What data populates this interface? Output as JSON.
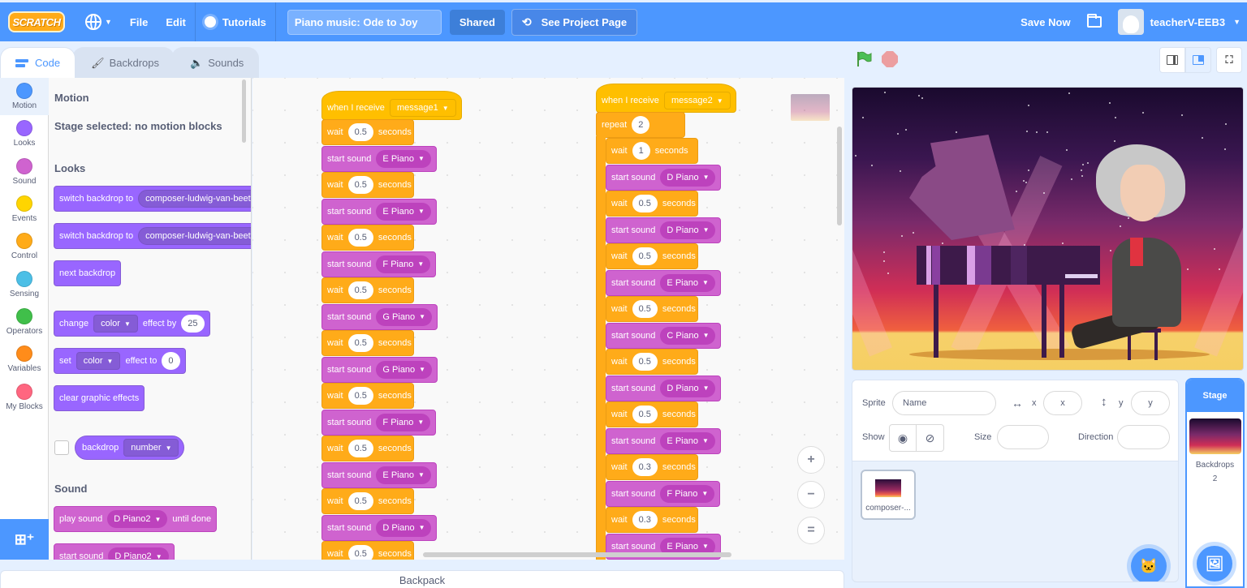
{
  "menubar": {
    "logo": "SCRATCH",
    "file": "File",
    "edit": "Edit",
    "tutorials": "Tutorials",
    "project_title": "Piano music: Ode to Joy",
    "shared": "Shared",
    "see_project_page": "See Project Page",
    "save_now": "Save Now",
    "username": "teacherV-EEB3"
  },
  "tabs": [
    {
      "label": "Code",
      "active": true
    },
    {
      "label": "Backdrops",
      "active": false
    },
    {
      "label": "Sounds",
      "active": false
    }
  ],
  "categories": [
    {
      "label": "Motion",
      "color": "#4c97ff"
    },
    {
      "label": "Looks",
      "color": "#9966ff"
    },
    {
      "label": "Sound",
      "color": "#cf63cf"
    },
    {
      "label": "Events",
      "color": "#ffd500"
    },
    {
      "label": "Control",
      "color": "#ffab19"
    },
    {
      "label": "Sensing",
      "color": "#4cbfe6"
    },
    {
      "label": "Operators",
      "color": "#40bf4a"
    },
    {
      "label": "Variables",
      "color": "#ff8c1a"
    },
    {
      "label": "My Blocks",
      "color": "#ff6680"
    }
  ],
  "palette": {
    "motion_heading": "Motion",
    "motion_note": "Stage selected: no motion blocks",
    "looks_heading": "Looks",
    "sound_heading": "Sound",
    "switch_backdrop_1": {
      "label": "switch backdrop to",
      "value": "composer-ludwig-van-beeth"
    },
    "switch_backdrop_2": {
      "label": "switch backdrop to",
      "value": "composer-ludwig-van-beeth"
    },
    "next_backdrop": "next backdrop",
    "change_effect": {
      "label1": "change",
      "dropdown": "color",
      "label2": "effect by",
      "value": "25"
    },
    "set_effect": {
      "label1": "set",
      "dropdown": "color",
      "label2": "effect to",
      "value": "0"
    },
    "clear_effects": "clear graphic effects",
    "backdrop_reporter": {
      "label": "backdrop",
      "dropdown": "number"
    },
    "play_sound": {
      "label1": "play sound",
      "dropdown": "D Piano2",
      "label2": "until done"
    },
    "start_sound": {
      "label": "start sound",
      "dropdown": "D Piano2"
    }
  },
  "scripts": {
    "script1": {
      "hat": {
        "label": "when I receive",
        "message": "message1"
      },
      "blocks": [
        {
          "type": "wait",
          "value": "0.5"
        },
        {
          "type": "sound",
          "note": "E Piano"
        },
        {
          "type": "wait",
          "value": "0.5"
        },
        {
          "type": "sound",
          "note": "E Piano"
        },
        {
          "type": "wait",
          "value": "0.5"
        },
        {
          "type": "sound",
          "note": "F Piano"
        },
        {
          "type": "wait",
          "value": "0.5"
        },
        {
          "type": "sound",
          "note": "G Piano"
        },
        {
          "type": "wait",
          "value": "0.5"
        },
        {
          "type": "sound",
          "note": "G Piano"
        },
        {
          "type": "wait",
          "value": "0.5"
        },
        {
          "type": "sound",
          "note": "F Piano"
        },
        {
          "type": "wait",
          "value": "0.5"
        },
        {
          "type": "sound",
          "note": "E Piano"
        },
        {
          "type": "wait",
          "value": "0.5"
        },
        {
          "type": "sound",
          "note": "D Piano"
        },
        {
          "type": "wait",
          "value": "0.5"
        }
      ]
    },
    "script2": {
      "hat": {
        "label": "when I receive",
        "message": "message2"
      },
      "repeat": {
        "label": "repeat",
        "value": "2"
      },
      "blocks": [
        {
          "type": "wait",
          "value": "1"
        },
        {
          "type": "sound",
          "note": "D Piano"
        },
        {
          "type": "wait",
          "value": "0.5"
        },
        {
          "type": "sound",
          "note": "D Piano"
        },
        {
          "type": "wait",
          "value": "0.5"
        },
        {
          "type": "sound",
          "note": "E Piano"
        },
        {
          "type": "wait",
          "value": "0.5"
        },
        {
          "type": "sound",
          "note": "C Piano"
        },
        {
          "type": "wait",
          "value": "0.5"
        },
        {
          "type": "sound",
          "note": "D Piano"
        },
        {
          "type": "wait",
          "value": "0.5"
        },
        {
          "type": "sound",
          "note": "E Piano"
        },
        {
          "type": "wait",
          "value": "0.3"
        },
        {
          "type": "sound",
          "note": "F Piano"
        },
        {
          "type": "wait",
          "value": "0.3"
        },
        {
          "type": "sound",
          "note": "E Piano"
        }
      ]
    },
    "wait_label": "wait",
    "seconds_label": "seconds",
    "start_sound_label": "start sound"
  },
  "zoom_controls": {
    "zoom_in": "+",
    "zoom_out": "−",
    "reset": "="
  },
  "backpack": "Backpack",
  "sprite_info": {
    "sprite_label": "Sprite",
    "name_placeholder": "Name",
    "x_label": "x",
    "x_placeholder": "x",
    "y_label": "y",
    "y_placeholder": "y",
    "show_label": "Show",
    "size_label": "Size",
    "direction_label": "Direction"
  },
  "sprites": [
    {
      "name": "composer-..."
    }
  ],
  "stage_pane": {
    "title": "Stage",
    "backdrops_label": "Backdrops",
    "backdrops_count": "2"
  }
}
